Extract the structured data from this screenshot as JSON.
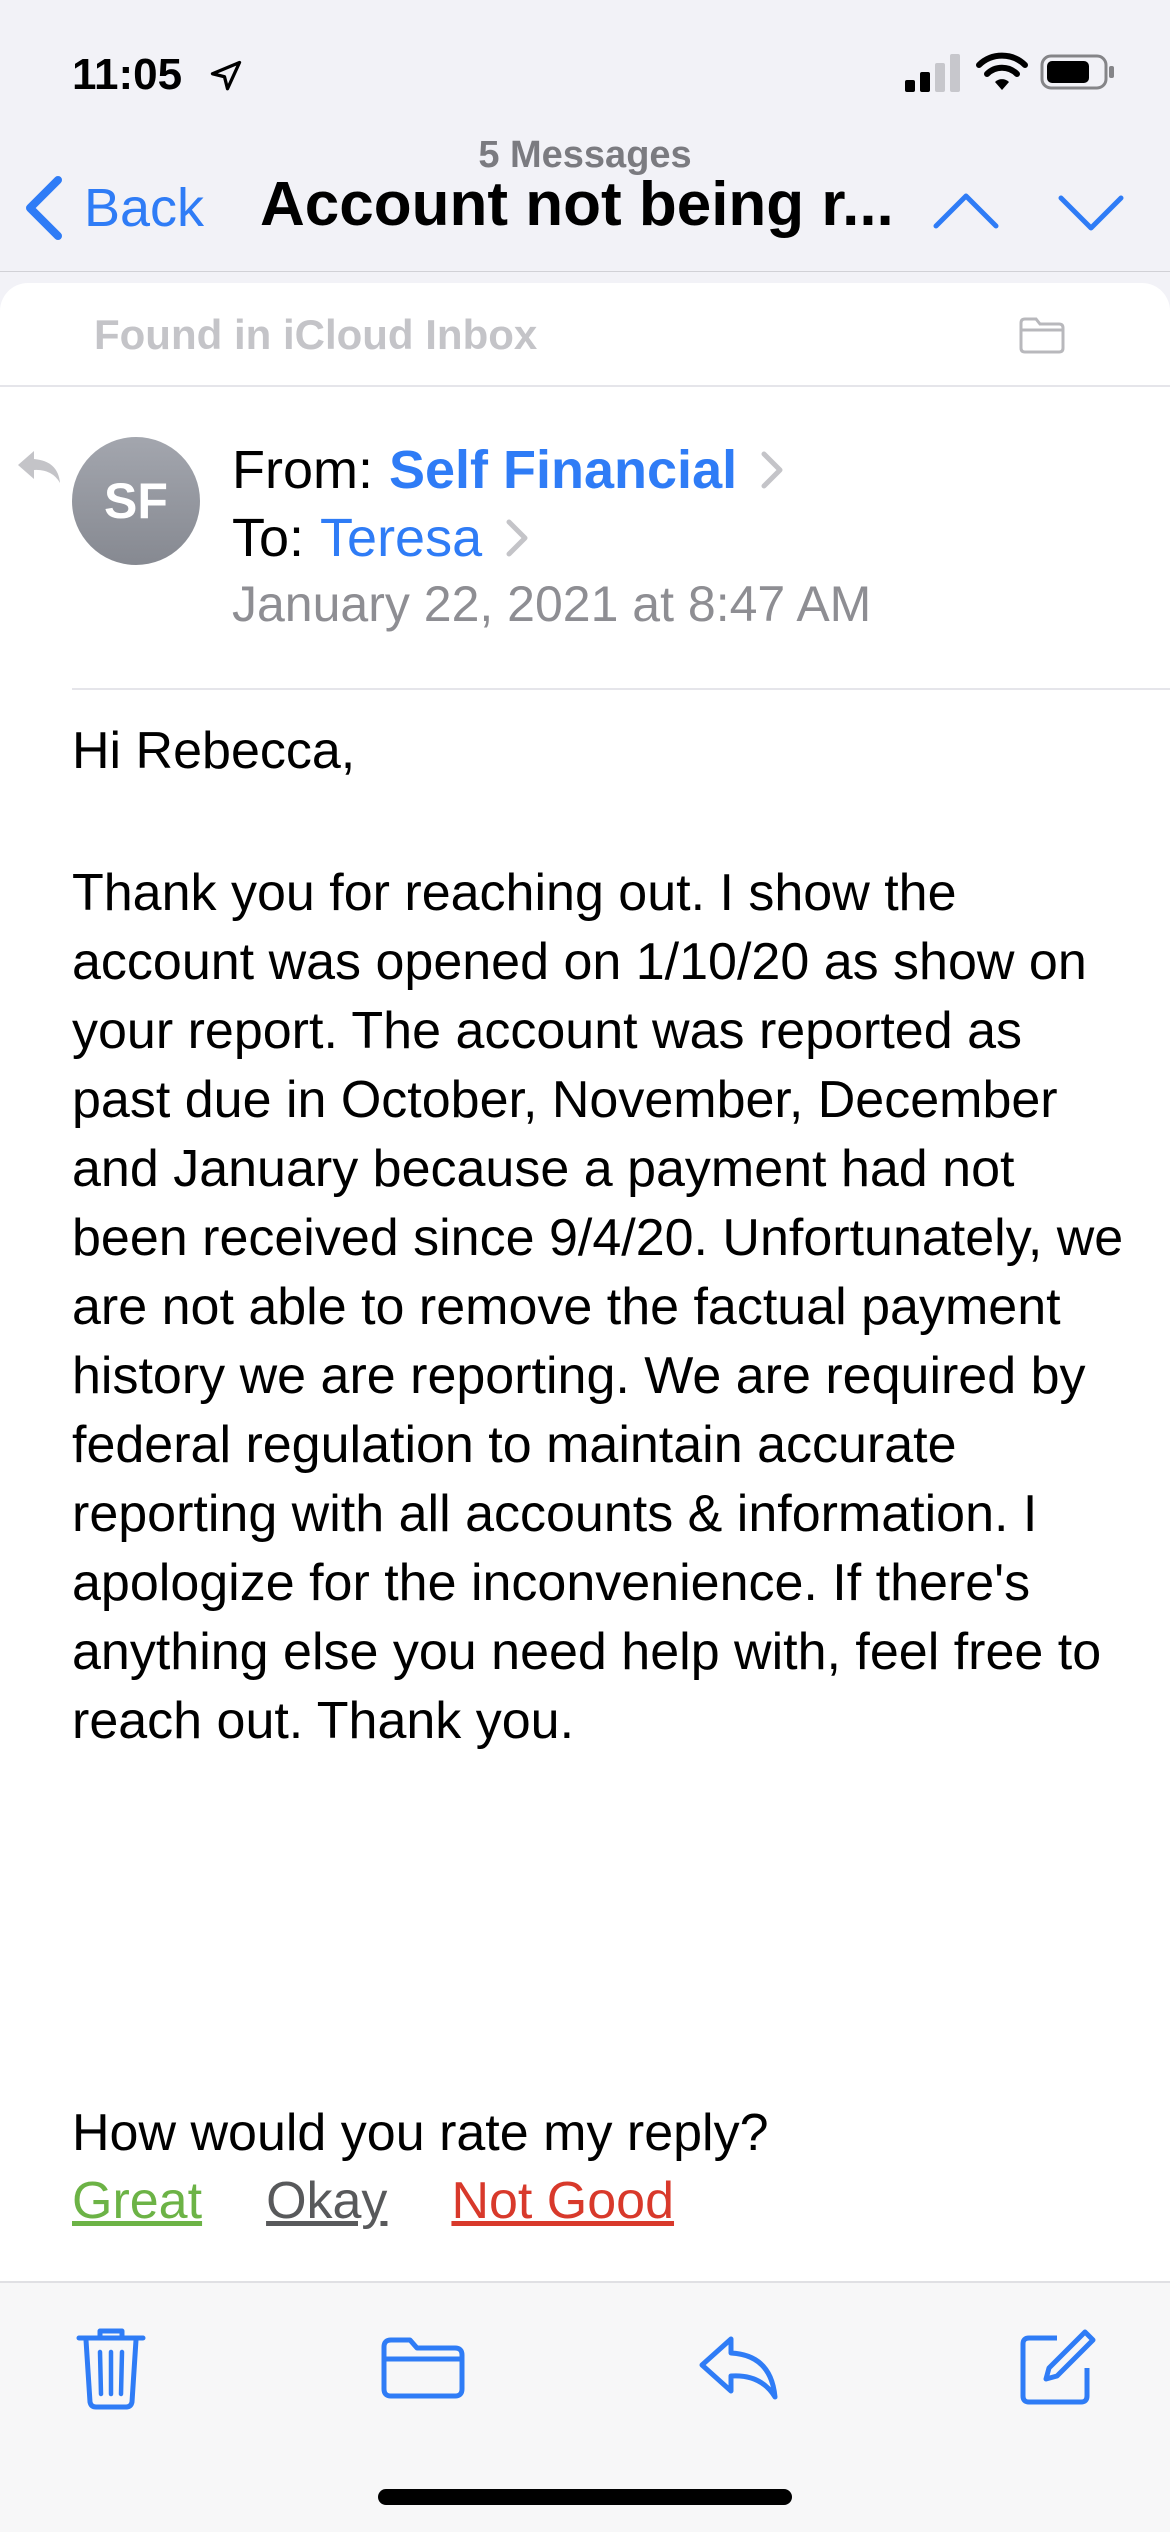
{
  "status_bar": {
    "time": "11:05"
  },
  "nav": {
    "back_label": "Back",
    "message_count": "5 Messages",
    "subject": "Account not being r..."
  },
  "found_bar": {
    "text": "Found in iCloud Inbox"
  },
  "header": {
    "avatar_initials": "SF",
    "from_label": "From:",
    "from_name": "Self Financial",
    "to_label": "To:",
    "to_name": "Teresa",
    "date": "January 22, 2021 at 8:47 AM"
  },
  "body": {
    "greeting": "Hi Rebecca,",
    "paragraph": "Thank you for reaching out. I show the account was opened on 1/10/20 as show on your report. The account was reported as past due in October, November, December and January because a payment had not been received since 9/4/20. Unfortunately, we are not able to remove the factual payment history we are reporting. We are required by federal regulation to maintain accurate reporting with all accounts & information. I apologize for the inconvenience. If there's anything else you need help with, feel free to reach out. Thank you.",
    "rating_question": "How would you rate my reply?",
    "rating_options": [
      "Great",
      "Okay",
      "Not Good"
    ]
  },
  "colors": {
    "accent": "#2f7cf6",
    "great": "#6cb346",
    "okay": "#58595b",
    "not_good": "#d8392b"
  },
  "toolbar": {
    "icons": [
      "trash-icon",
      "folder-icon",
      "reply-icon",
      "compose-icon"
    ]
  }
}
